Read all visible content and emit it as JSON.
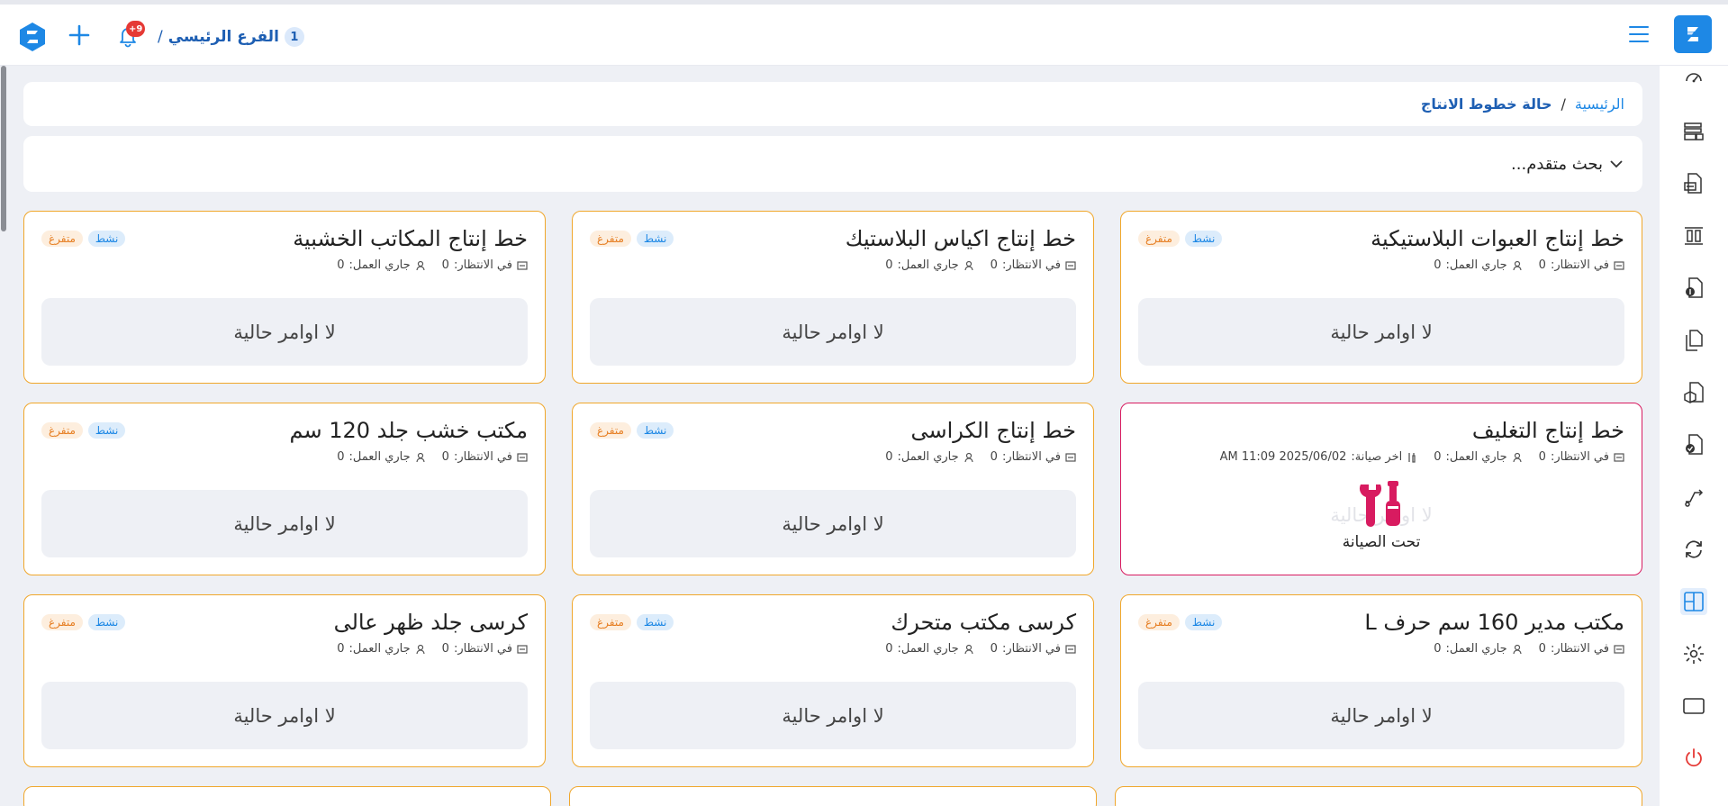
{
  "header": {
    "branch_number": "1",
    "branch_name": "الفرع الرئيسي",
    "branch_separator": "/",
    "notification_badge": "+9",
    "logo_icon": "brand-logo-icon",
    "menu_icon": "hamburger-menu-icon",
    "add_icon": "plus-icon",
    "bell_icon": "bell-icon"
  },
  "breadcrumb": {
    "home": "الرئيسية",
    "separator": "/",
    "current": "حالة خطوط الانتاج"
  },
  "search": {
    "label": "بحث متقدم..."
  },
  "sidebar": {
    "icons": [
      "dashboard-icon",
      "warehouse-icon",
      "invoice-icon",
      "columns-icon",
      "finance-doc-icon",
      "documents-icon",
      "stock-doc-icon",
      "approved-doc-icon",
      "transfer-icon",
      "sync-icon",
      "layout-icon",
      "settings-icon",
      "window-icon",
      "power-icon"
    ],
    "active_index": 10
  },
  "colors": {
    "accent": "#1e88e5",
    "card_border": "#f0a72b",
    "maintenance_border": "#d81b60",
    "maintenance_icon": "#d81b60"
  },
  "labels": {
    "status_active": "نشط",
    "status_idle": "متفرغ",
    "waiting": "في الانتظار:",
    "working": "جاري العمل:",
    "last_maintenance": "اخر صيانة:",
    "no_orders": "لا اوامر حالية",
    "under_maintenance": "تحت الصيانة"
  },
  "cards": [
    {
      "title": "خط إنتاج العبوات البلاستيكية",
      "waiting": "0",
      "working": "0",
      "maintenance": false
    },
    {
      "title": "خط إنتاج اكياس البلاستيك",
      "waiting": "0",
      "working": "0",
      "maintenance": false
    },
    {
      "title": "خط إنتاج المكاتب الخشبية",
      "waiting": "0",
      "working": "0",
      "maintenance": false
    },
    {
      "title": "خط إنتاج التغليف",
      "waiting": "0",
      "working": "0",
      "maintenance": true,
      "last_maintenance": "2025/06/02 11:09 AM"
    },
    {
      "title": "خط إنتاج الكراسى",
      "waiting": "0",
      "working": "0",
      "maintenance": false
    },
    {
      "title": "مكتب خشب جلد 120 سم",
      "waiting": "0",
      "working": "0",
      "maintenance": false
    },
    {
      "title": "مكتب مدير 160 سم حرف L",
      "waiting": "0",
      "working": "0",
      "maintenance": false
    },
    {
      "title": "كرسى مكتب متحرك",
      "waiting": "0",
      "working": "0",
      "maintenance": false
    },
    {
      "title": "كرسى جلد ظهر عالى",
      "waiting": "0",
      "working": "0",
      "maintenance": false
    }
  ]
}
